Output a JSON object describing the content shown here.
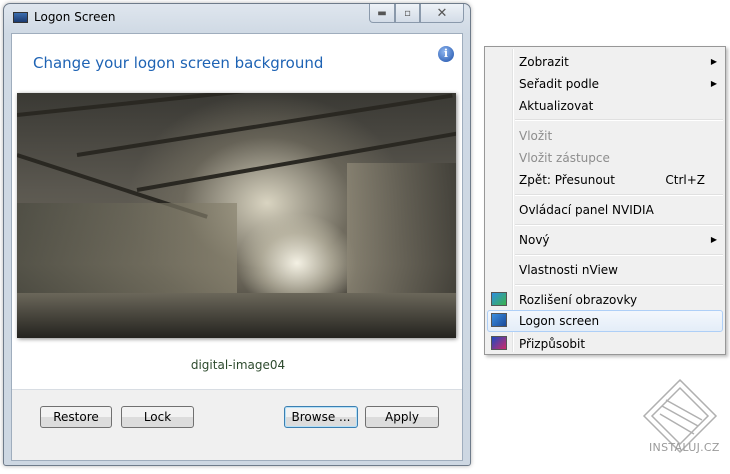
{
  "window": {
    "title": "Logon Screen",
    "heading": "Change your logon screen background",
    "caption": "digital-image04",
    "buttons": {
      "restore": "Restore",
      "lock": "Lock",
      "browse": "Browse ...",
      "apply": "Apply"
    }
  },
  "menu": {
    "items": [
      {
        "label": "Zobrazit",
        "submenu": true
      },
      {
        "label": "Seřadit podle",
        "submenu": true
      },
      {
        "label": "Aktualizovat"
      },
      {
        "label": "Vložit",
        "disabled": true
      },
      {
        "label": "Vložit zástupce",
        "disabled": true
      },
      {
        "label": "Zpět: Přesunout",
        "shortcut": "Ctrl+Z"
      },
      {
        "label": "Ovládací panel NVIDIA"
      },
      {
        "label": "Nový",
        "submenu": true
      },
      {
        "label": "Vlastnosti nView"
      },
      {
        "label": "Rozlišení obrazovky"
      },
      {
        "label": "Logon screen",
        "highlighted": true
      },
      {
        "label": "Přizpůsobit"
      }
    ]
  },
  "watermark": "INSTALUJ.CZ"
}
